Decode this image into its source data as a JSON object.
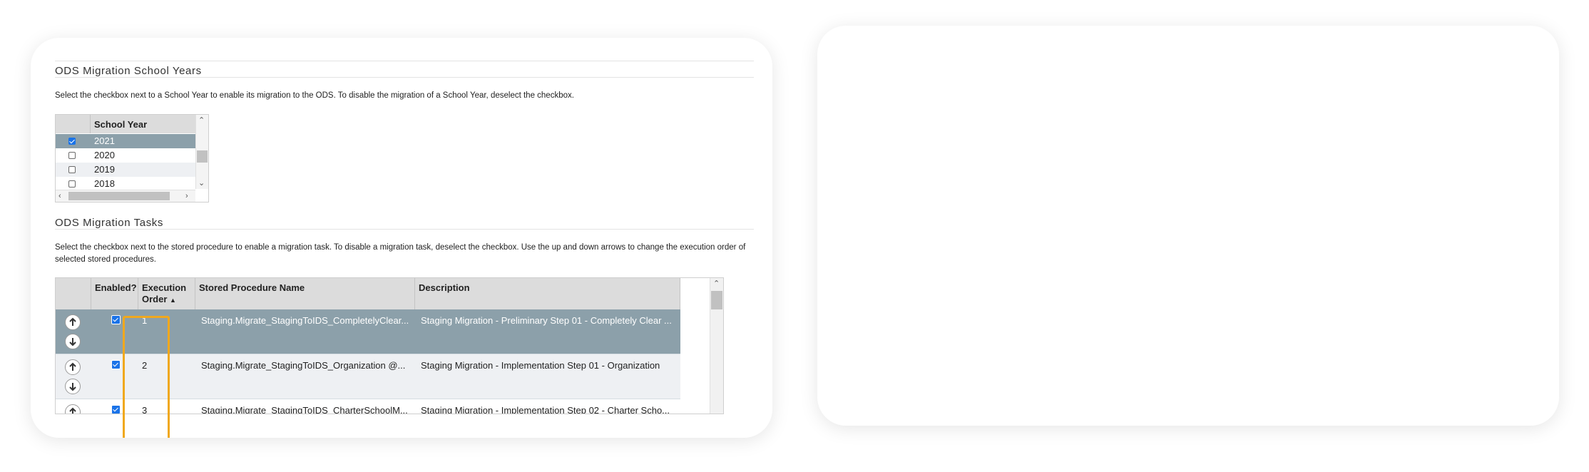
{
  "school_years_section": {
    "title": "ODS Migration School Years",
    "instructions": "Select the checkbox next to a School Year to enable its migration to the ODS. To disable the migration of a School Year, deselect the checkbox.",
    "column_header": "School Year",
    "rows": [
      {
        "year": "2021",
        "checked": true,
        "selected": true
      },
      {
        "year": "2020",
        "checked": false
      },
      {
        "year": "2019",
        "checked": false
      },
      {
        "year": "2018",
        "checked": false
      }
    ]
  },
  "tasks_section": {
    "title": "ODS Migration Tasks",
    "instructions": "Select the checkbox next to the stored procedure to enable a migration task. To disable a migration task, deselect the checkbox. Use the up and down arrows to change the execution order of selected stored procedures.",
    "columns": {
      "enabled": "Enabled?",
      "execution_order_line1": "Execution",
      "execution_order_line2": "Order",
      "sort_indicator": "▲",
      "procedure": "Stored Procedure Name",
      "description": "Description"
    },
    "rows": [
      {
        "order": "1",
        "procedure": "Staging.Migrate_StagingToIDS_CompletelyClear...",
        "description": "Staging Migration - Preliminary Step 01 - Completely Clear ...",
        "enabled": true
      },
      {
        "order": "2",
        "procedure": "Staging.Migrate_StagingToIDS_Organization @...",
        "description": "Staging Migration - Implementation Step 01 - Organization",
        "enabled": true
      },
      {
        "order": "3",
        "procedure": "Staging.Migrate_StagingToIDS_CharterSchoolM...",
        "description": "Staging Migration - Implementation Step 02 - Charter Scho...",
        "enabled": true
      }
    ]
  },
  "colors": {
    "selected_row": "#8ca0aa",
    "alt_row": "#eef0f3",
    "checkbox": "#1a73e8",
    "highlight": "#f0a81d"
  }
}
